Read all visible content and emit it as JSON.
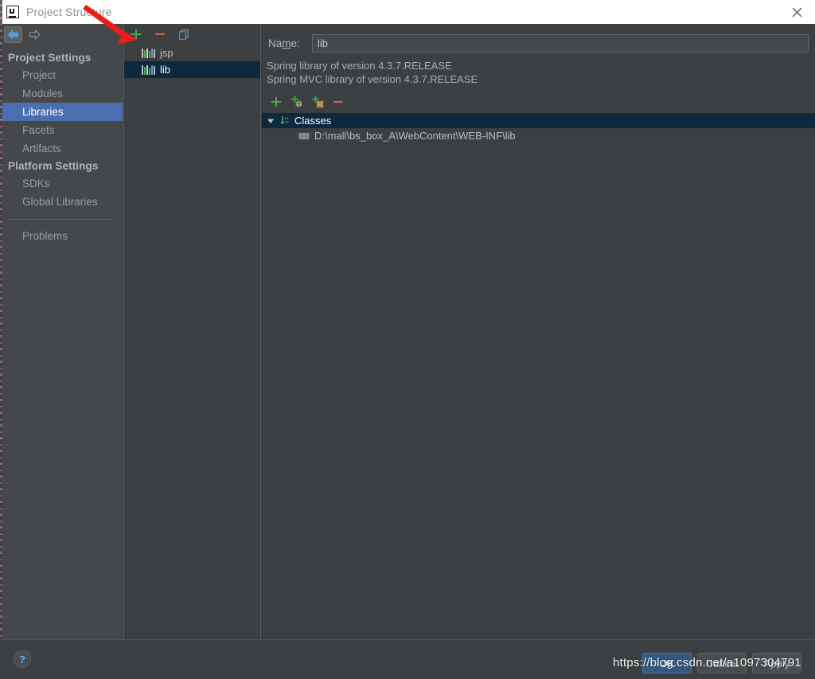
{
  "window": {
    "title": "Project Structure",
    "logo_icon": "intellij-idea-logo",
    "close_icon": "close-icon"
  },
  "nav": {
    "back_icon": "arrow-left-icon",
    "forward_icon": "arrow-right-icon"
  },
  "sidebar": {
    "groups": [
      {
        "label": "Project Settings",
        "items": [
          {
            "label": "Project",
            "selected": false
          },
          {
            "label": "Modules",
            "selected": false
          },
          {
            "label": "Libraries",
            "selected": true
          },
          {
            "label": "Facets",
            "selected": false
          },
          {
            "label": "Artifacts",
            "selected": false
          }
        ]
      },
      {
        "label": "Platform Settings",
        "items": [
          {
            "label": "SDKs",
            "selected": false
          },
          {
            "label": "Global Libraries",
            "selected": false
          }
        ]
      }
    ],
    "footer_items": [
      {
        "label": "Problems",
        "selected": false
      }
    ]
  },
  "library_panel": {
    "toolbar": [
      {
        "name": "add-library-button",
        "icon": "plus-icon",
        "label": "+"
      },
      {
        "name": "remove-library-button",
        "icon": "minus-icon",
        "label": "−"
      },
      {
        "name": "copy-library-button",
        "icon": "copy-icon",
        "label": ""
      }
    ],
    "items": [
      {
        "label": "jsp",
        "icon": "library-icon",
        "selected": false
      },
      {
        "label": "lib",
        "icon": "library-icon",
        "selected": true
      }
    ]
  },
  "detail": {
    "name_label_pre": "Na",
    "name_label_mnemonic": "m",
    "name_label_post": "e:",
    "name_value": "lib",
    "name_placeholder": "",
    "descriptions": [
      "Spring library of version 4.3.7.RELEASE",
      "Spring MVC library of version 4.3.7.RELEASE"
    ],
    "classes_toolbar": [
      {
        "name": "add-classes-button",
        "icon": "plus-icon"
      },
      {
        "name": "add-from-maven-button",
        "icon": "plus-globe-icon"
      },
      {
        "name": "add-from-module-button",
        "icon": "plus-package-icon"
      },
      {
        "name": "remove-entry-button",
        "icon": "minus-icon"
      }
    ],
    "tree": {
      "root": {
        "label": "Classes",
        "icon": "classes-folder-icon",
        "expanded": true,
        "selected": true,
        "toggle_icon": "triangle-down-icon"
      },
      "children": [
        {
          "label": "D:\\mall\\bs_box_A\\WebContent\\WEB-INF\\lib",
          "icon": "folder-icon",
          "selected": false
        }
      ]
    }
  },
  "footer": {
    "help_label": "?",
    "help_icon": "help-icon",
    "buttons": [
      {
        "label": "OK",
        "name": "ok-button",
        "default": true
      },
      {
        "label": "Cancel",
        "name": "cancel-button",
        "default": false
      },
      {
        "label": "Apply",
        "name": "apply-button",
        "default": false
      }
    ]
  },
  "annotations": {
    "watermark_text": "https://blog.csdn.net/a1097304791",
    "arrow_color": "#ee1c18"
  },
  "colors": {
    "window_bg": "#3c3f41",
    "sidebar_bg": "#45484a",
    "selection_blue": "#4b6eaf",
    "tree_selection": "#0d293e",
    "accent_green": "#4ca64c",
    "accent_red": "#d4624f",
    "titlebar_bg": "#ffffff"
  }
}
